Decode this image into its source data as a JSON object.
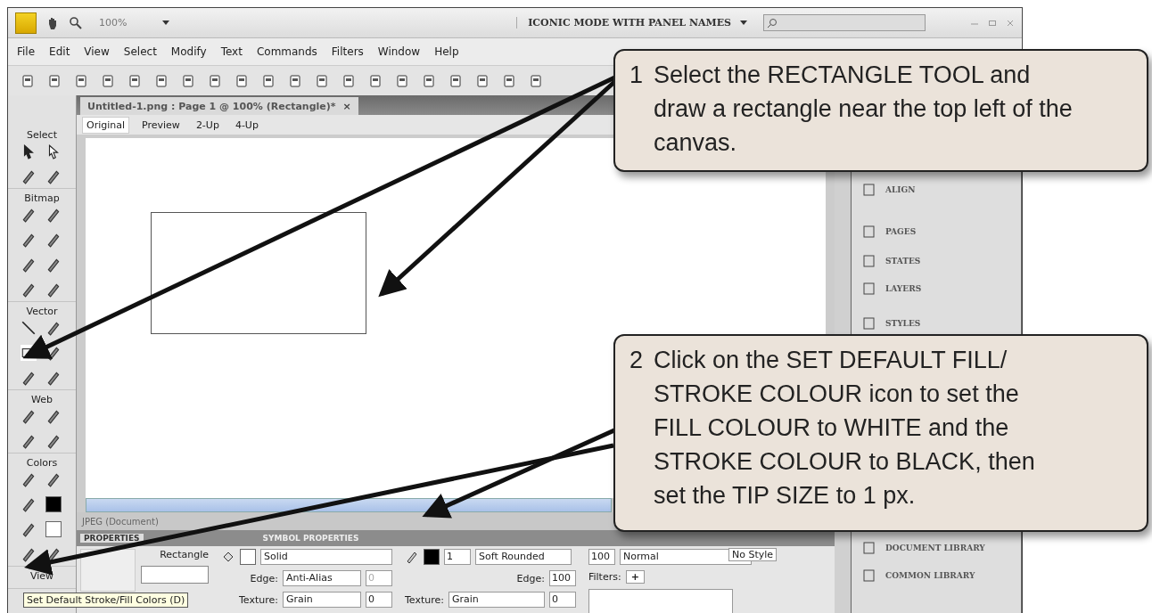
{
  "title_bar": {
    "zoom": "100%",
    "workspace": "ICONIC MODE WITH PANEL NAMES"
  },
  "menu": [
    "File",
    "Edit",
    "View",
    "Select",
    "Modify",
    "Text",
    "Commands",
    "Filters",
    "Window",
    "Help"
  ],
  "document_tab": {
    "title": "Untitled-1.png : Page 1 @ 100% (Rectangle)*",
    "close": "×"
  },
  "view_modes": [
    {
      "label": "Original",
      "selected": true
    },
    {
      "label": "Preview",
      "selected": false
    },
    {
      "label": "2-Up",
      "selected": false
    },
    {
      "label": "4-Up",
      "selected": false
    }
  ],
  "tool_sections": [
    {
      "label": "Select"
    },
    {
      "label": "Bitmap"
    },
    {
      "label": "Vector"
    },
    {
      "label": "Web"
    },
    {
      "label": "Colors"
    },
    {
      "label": "View"
    }
  ],
  "panels": [
    {
      "label": "ALIGN"
    },
    {
      "label": "PAGES"
    },
    {
      "label": "STATES"
    },
    {
      "label": "LAYERS"
    },
    {
      "label": "STYLES"
    },
    {
      "label": "DOCUMENT LIBRARY"
    },
    {
      "label": "COMMON LIBRARY"
    }
  ],
  "status": "JPEG (Document)",
  "properties": {
    "tabs": [
      {
        "label": "PROPERTIES",
        "selected": true
      },
      {
        "label": "SYMBOL PROPERTIES",
        "selected": false
      }
    ],
    "object": "Rectangle",
    "fill_type": "Solid",
    "fill_edge_label": "Edge:",
    "fill_edge": "Anti-Alias",
    "fill_edge_value": "0",
    "fill_texture_label": "Texture:",
    "fill_texture": "Grain",
    "fill_texture_value": "0",
    "tip_size": "1",
    "stroke_type": "Soft Rounded",
    "stroke_edge_label": "Edge:",
    "stroke_edge_value": "100",
    "stroke_texture_label": "Texture:",
    "stroke_texture": "Grain",
    "stroke_texture_value": "0",
    "opacity": "100",
    "blend": "Normal",
    "filters_label": "Filters:",
    "filters_add": "+",
    "style": "No Style"
  },
  "tooltip": "Set Default Stroke/Fill Colors (D)",
  "callouts": [
    {
      "number": "1",
      "text": "Select the RECTANGLE TOOL and draw a rectangle near the top left of the canvas."
    },
    {
      "number": "2",
      "text": "Click on the SET DEFAULT FILL/ STROKE COLOUR icon to set the FILL COLOUR to WHITE and the STROKE COLOUR to BLACK, then set the TIP SIZE to 1 px."
    }
  ]
}
